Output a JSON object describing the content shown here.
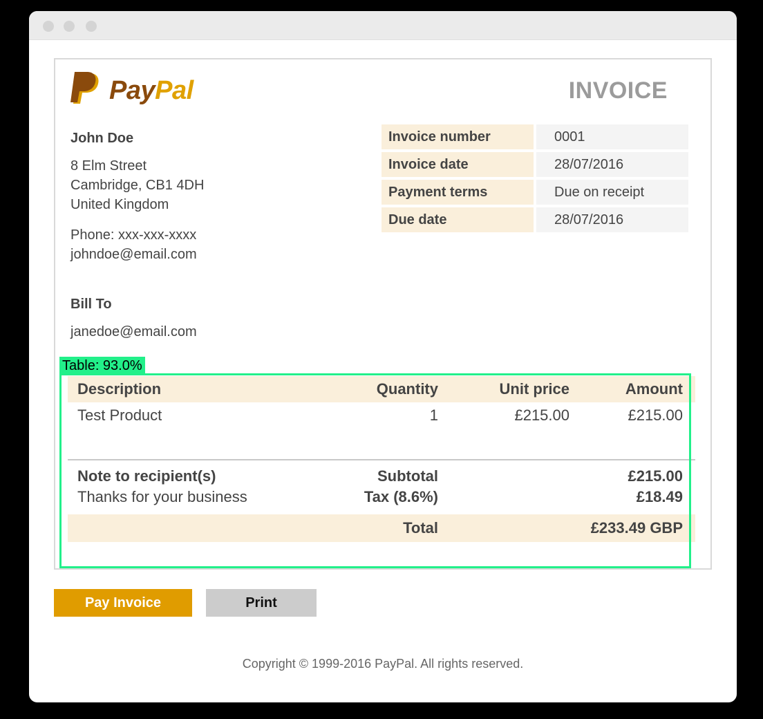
{
  "brand": {
    "pay": "Pay",
    "pal": "Pal",
    "primary_color": "#8a4a0c",
    "accent_color": "#e0a100"
  },
  "invoice": {
    "heading": "INVOICE"
  },
  "sender": {
    "name": "John Doe",
    "address": [
      "8 Elm Street",
      "Cambridge, CB1 4DH",
      "United Kingdom"
    ],
    "phone": "Phone: xxx-xxx-xxxx",
    "email": "johndoe@email.com"
  },
  "meta": [
    {
      "key": "Invoice number",
      "value": "0001"
    },
    {
      "key": "Invoice date",
      "value": "28/07/2016"
    },
    {
      "key": "Payment terms",
      "value": "Due on receipt"
    },
    {
      "key": "Due date",
      "value": "28/07/2016"
    }
  ],
  "bill_to": {
    "label": "Bill To",
    "email": "janedoe@email.com"
  },
  "items": {
    "headers": {
      "description": "Description",
      "quantity": "Quantity",
      "unit_price": "Unit price",
      "amount": "Amount"
    },
    "rows": [
      {
        "description": "Test Product",
        "quantity": "1",
        "unit_price": "£215.00",
        "amount": "£215.00"
      }
    ]
  },
  "summary": {
    "note_label": "Note to recipient(s)",
    "note_text": "Thanks for your business",
    "subtotal_label": "Subtotal",
    "subtotal_value": "£215.00",
    "tax_label": "Tax (8.6%)",
    "tax_value": "£18.49",
    "total_label": "Total",
    "total_value": "£233.49 GBP"
  },
  "detection": {
    "label": "Table: 93.0%",
    "color": "#22f08a"
  },
  "actions": {
    "pay_label": "Pay Invoice",
    "print_label": "Print"
  },
  "footer": {
    "copyright": "Copyright © 1999-2016 PayPal. All rights reserved."
  }
}
